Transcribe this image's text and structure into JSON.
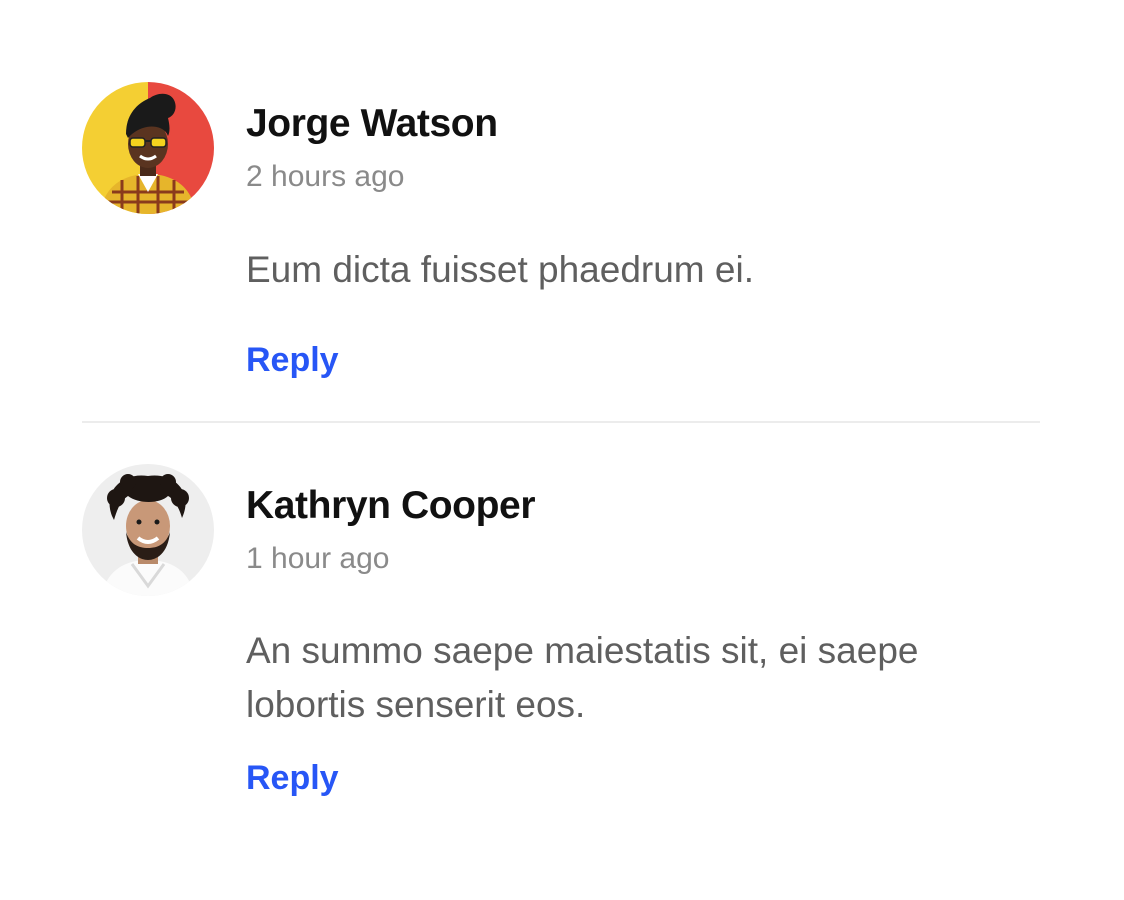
{
  "comments": [
    {
      "author": "Jorge Watson",
      "time": "2 hours ago",
      "text": "Eum dicta fuisset phaedrum ei.",
      "reply_label": "Reply",
      "avatar_icon": "avatar-photo"
    },
    {
      "author": "Kathryn Cooper",
      "time": "1 hour ago",
      "text": "An summo saepe maiestatis sit, ei saepe lobortis senserit eos.",
      "reply_label": "Reply",
      "avatar_icon": "avatar-photo"
    }
  ],
  "colors": {
    "accent": "#2756f6",
    "author": "#111111",
    "muted": "#8a8a8a",
    "body_text": "#5f5f5f",
    "divider": "#ececec"
  }
}
